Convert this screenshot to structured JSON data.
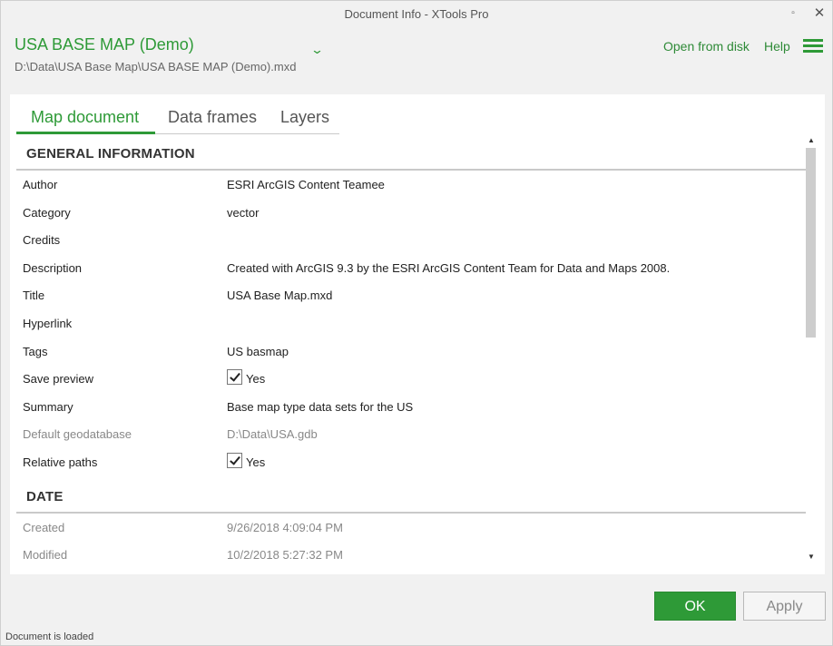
{
  "window": {
    "title": "Document Info - XTools Pro",
    "maximize_glyph": "▫",
    "close_glyph": "✕"
  },
  "document": {
    "name": "USA BASE MAP (Demo)",
    "path": "D:\\Data\\USA Base Map\\USA BASE MAP (Demo).mxd",
    "chevron_glyph": "⌄"
  },
  "toolbar": {
    "open_from_disk": "Open from disk",
    "help": "Help"
  },
  "tabs": [
    "Map document",
    "Data frames",
    "Layers"
  ],
  "general": {
    "heading": "GENERAL INFORMATION",
    "rows": [
      {
        "label": "Author",
        "value": "ESRI ArcGIS Content Teamee"
      },
      {
        "label": "Category",
        "value": "vector"
      },
      {
        "label": "Credits",
        "value": ""
      },
      {
        "label": "Description",
        "value": "Created with ArcGIS 9.3 by the ESRI ArcGIS Content Team for Data and Maps 2008."
      },
      {
        "label": "Title",
        "value": "USA Base Map.mxd"
      },
      {
        "label": "Hyperlink",
        "value": ""
      },
      {
        "label": "Tags",
        "value": "US basmap"
      },
      {
        "label": "Save preview",
        "value": "Yes"
      },
      {
        "label": "Summary",
        "value": "Base map type data sets for the US"
      },
      {
        "label": "Default geodatabase",
        "value": "D:\\Data\\USA.gdb"
      },
      {
        "label": "Relative paths",
        "value": "Yes"
      }
    ]
  },
  "date": {
    "heading": "DATE",
    "rows": [
      {
        "label": "Created",
        "value": "9/26/2018 4:09:04 PM"
      },
      {
        "label": "Modified",
        "value": "10/2/2018 5:27:32 PM"
      }
    ]
  },
  "scroll": {
    "up_glyph": "▲",
    "down_glyph": "▼",
    "position": 0.0,
    "visible_fraction": 0.47
  },
  "buttons": {
    "ok": "OK",
    "apply": "Apply"
  },
  "status": "Document is loaded",
  "colors": {
    "accent": "#2e9a37",
    "muted_text": "#888888"
  }
}
